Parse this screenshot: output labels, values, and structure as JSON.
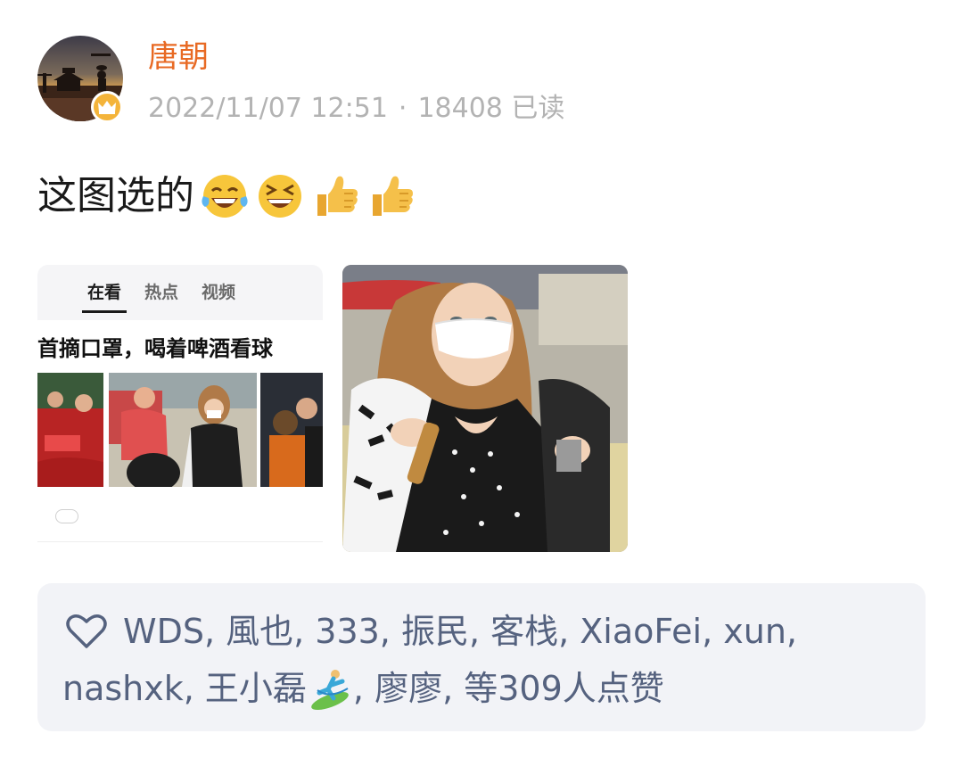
{
  "post": {
    "username": "唐朝",
    "date": "2022/11/07 12:51",
    "separator": "·",
    "reads": "18408 已读",
    "text": "这图选的",
    "emojis": [
      "laughing-tears-emoji",
      "grinning-squint-emoji",
      "thumbs-up-emoji",
      "thumbs-up-emoji"
    ]
  },
  "news_image": {
    "tabs": [
      "在看",
      "热点",
      "视频"
    ],
    "active_tab": 0,
    "headline": "首摘口罩，喝着啤酒看球"
  },
  "likes": {
    "line1": "WDS, 風也, 333, 振民, 客栈, XiaoFei, xun,",
    "line2_before": "nashxk, 王小磊",
    "line2_after": ", 廖廖, 等309人点赞"
  },
  "colors": {
    "username": "#e86a24",
    "meta": "#b3b3b3",
    "likes_text": "#55627f",
    "likes_bg": "#f2f3f7",
    "badge": "#f4b43a"
  }
}
